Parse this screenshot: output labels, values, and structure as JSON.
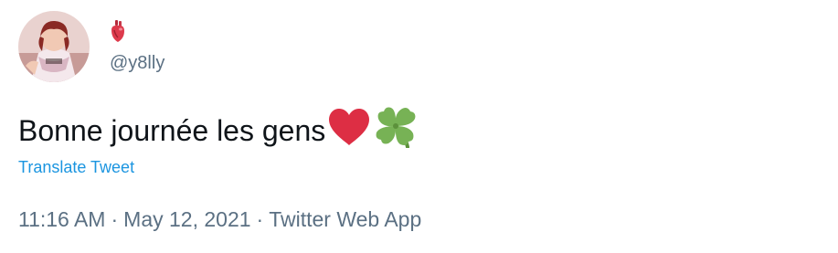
{
  "user": {
    "display_name_icon": "anatomical-heart-emoji",
    "handle": "@y8lly"
  },
  "tweet": {
    "text": "Bonne journée les gens",
    "emojis": [
      "red-heart-emoji",
      "four-leaf-clover-emoji"
    ],
    "translate_label": "Translate Tweet"
  },
  "meta": {
    "time": "11:16 AM",
    "separator": "·",
    "date": "May 12, 2021",
    "source": "Twitter Web App"
  },
  "colors": {
    "text": "#0f1419",
    "secondary": "#5b7083",
    "link": "#1b95e0",
    "heart": "#dd2e44",
    "clover": "#77b255"
  }
}
